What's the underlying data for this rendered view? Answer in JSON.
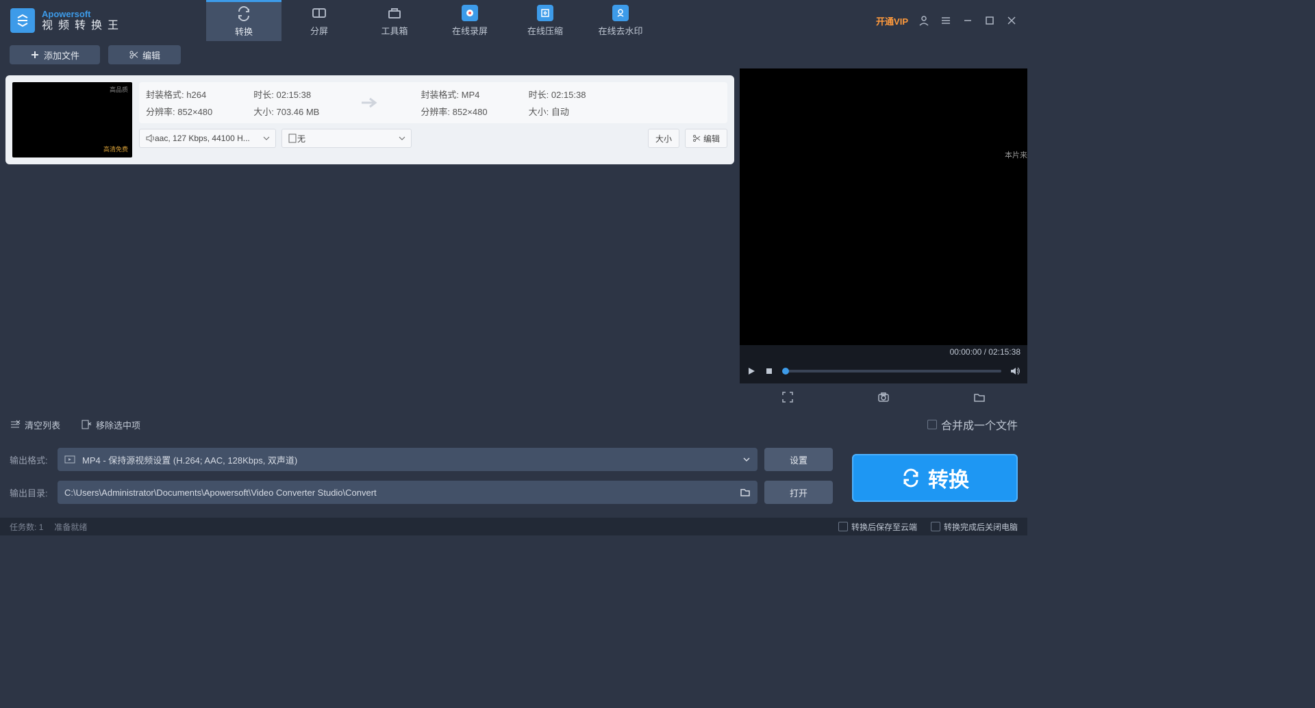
{
  "logo": {
    "brand": "Apowersoft",
    "app": "视频转换王"
  },
  "vip": "开通VIP",
  "tabs": [
    {
      "label": "转换"
    },
    {
      "label": "分屏"
    },
    {
      "label": "工具箱"
    },
    {
      "label": "在线录屏"
    },
    {
      "label": "在线压缩"
    },
    {
      "label": "在线去水印"
    }
  ],
  "toolbar": {
    "add": "添加文件",
    "edit": "编辑"
  },
  "file": {
    "src": {
      "fmt_label": "封装格式:",
      "fmt": "h264",
      "dur_label": "时长:",
      "dur": "02:15:38",
      "res_label": "分辨率:",
      "res": "852×480",
      "size_label": "大小:",
      "size": "703.46 MB"
    },
    "dst": {
      "fmt_label": "封装格式:",
      "fmt": "MP4",
      "dur_label": "时长:",
      "dur": "02:15:38",
      "res_label": "分辨率:",
      "res": "852×480",
      "size_label": "大小:",
      "size": "自动"
    },
    "audio_dd": "aac, 127 Kbps, 44100 H...",
    "sub_dd": "无",
    "btn_size": "大小",
    "btn_edit": "编辑",
    "thumb_top": "高品质",
    "thumb_bot": "高清免费"
  },
  "midbar": {
    "clear": "清空列表",
    "remove": "移除选中项",
    "merge": "合并成一个文件"
  },
  "preview": {
    "badge": "本片来",
    "time": "00:00:00 / 02:15:38"
  },
  "output": {
    "fmt_label": "输出格式:",
    "fmt_value": "MP4 - 保持源视频设置 (H.264; AAC, 128Kbps, 双声道)",
    "dir_label": "输出目录:",
    "dir_value": "C:\\Users\\Administrator\\Documents\\Apowersoft\\Video Converter Studio\\Convert",
    "settings": "设置",
    "open": "打开",
    "convert": "转换"
  },
  "status": {
    "tasks_label": "任务数:",
    "tasks_n": "1",
    "ready": "准备就绪",
    "save_cloud": "转换后保存至云端",
    "shutdown": "转换完成后关闭电脑"
  }
}
